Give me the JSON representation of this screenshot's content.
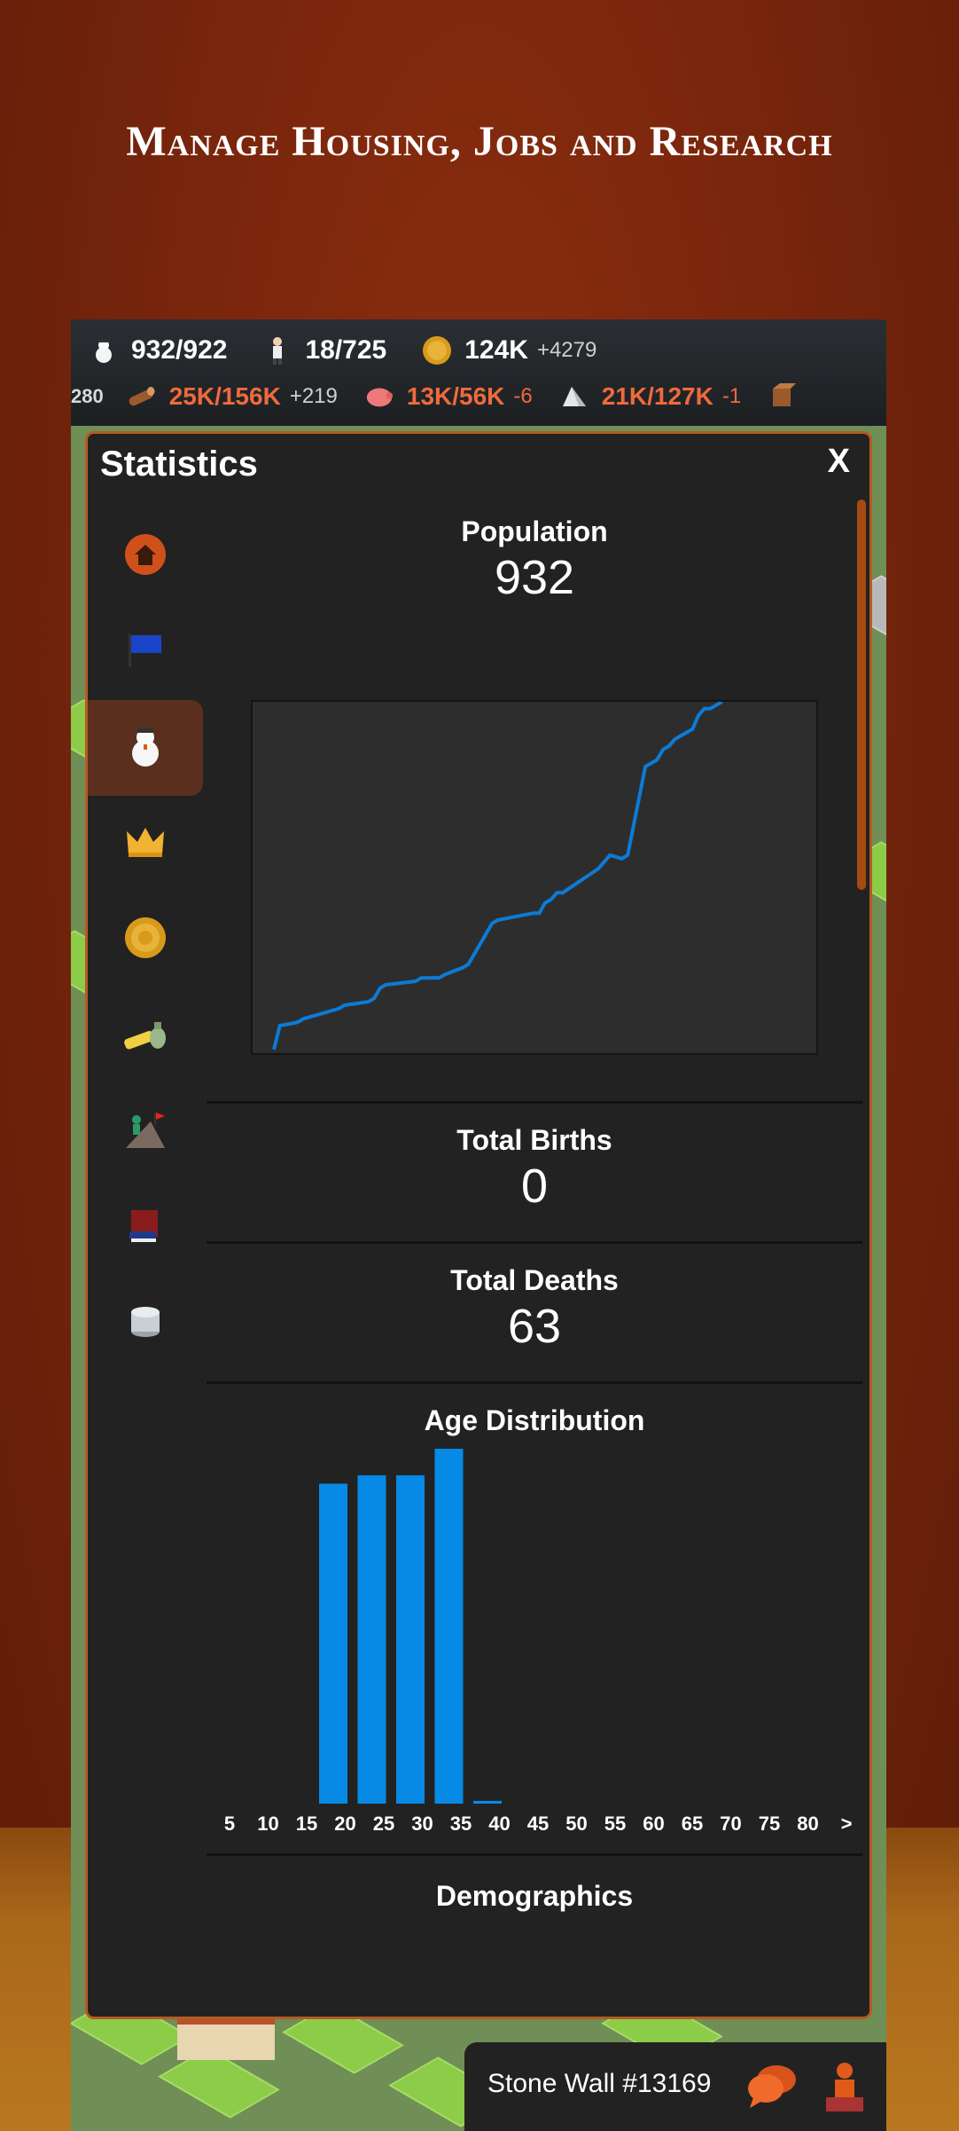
{
  "headline": "Manage Housing, Jobs and Research",
  "topbar": {
    "population": {
      "icon": "snowman-icon",
      "value": "932/922"
    },
    "workers": {
      "icon": "worker-icon",
      "value": "18/725"
    },
    "gold": {
      "icon": "coin-icon",
      "value": "124K",
      "delta": "+4279"
    },
    "cut_left": "280",
    "wood": {
      "icon": "wood-log-icon",
      "value": "25K/156K",
      "delta": "+219"
    },
    "food": {
      "icon": "pig-icon",
      "value": "13K/56K",
      "delta": "-6"
    },
    "stone": {
      "icon": "stone-icon",
      "value": "21K/127K",
      "delta": "-1"
    },
    "colors": {
      "warn": "#ef6a3c",
      "accent": "#b65a22",
      "bar": "#068ae6"
    }
  },
  "panel": {
    "title": "Statistics",
    "close_label": "X",
    "tabs": [
      {
        "name": "home-icon",
        "active": false
      },
      {
        "name": "flag-icon",
        "active": false
      },
      {
        "name": "snowman-icon",
        "active": true
      },
      {
        "name": "crown-icon",
        "active": false
      },
      {
        "name": "coin-icon",
        "active": false
      },
      {
        "name": "bread-resources-icon",
        "active": false
      },
      {
        "name": "climber-icon",
        "active": false
      },
      {
        "name": "books-icon",
        "active": false
      },
      {
        "name": "coins-stack-icon",
        "active": false
      }
    ],
    "population_label": "Population",
    "population_value": "932",
    "births_label": "Total Births",
    "births_value": "0",
    "deaths_label": "Total Deaths",
    "deaths_value": "63",
    "age_label": "Age Distribution",
    "demographics_label": "Demographics"
  },
  "chart_data": [
    {
      "type": "line",
      "series": [
        {
          "x": [
            0,
            1,
            4,
            5,
            11,
            12,
            16,
            17,
            18,
            19,
            24,
            25,
            28,
            29,
            32,
            33,
            37,
            38,
            44,
            45,
            46,
            47,
            48,
            49,
            55,
            56,
            57,
            59,
            60,
            63,
            64,
            65,
            66,
            67,
            68,
            69,
            70,
            71,
            72,
            73,
            74,
            75,
            76
          ],
          "y": [
            0,
            7,
            8,
            9,
            12,
            13,
            14,
            15,
            18,
            19,
            20,
            21,
            21,
            22,
            24,
            25,
            37,
            38,
            40,
            40,
            43,
            44,
            46,
            46,
            53,
            55,
            57,
            56,
            57,
            83,
            84,
            85,
            88,
            89,
            91,
            92,
            93,
            94,
            98,
            100,
            100,
            101,
            102
          ]
        }
      ],
      "grid": false
    },
    {
      "type": "bar",
      "categories": [
        "5",
        "10",
        "15",
        "20",
        "25",
        "30",
        "35",
        "40",
        "45",
        "50",
        "55",
        "60",
        "65",
        "70",
        "75",
        "80",
        ">"
      ],
      "values": [
        0,
        0,
        229,
        235,
        235,
        254,
        2,
        0,
        0,
        0,
        0,
        0,
        0,
        0,
        0,
        0,
        0
      ],
      "title": "Age Distribution"
    }
  ],
  "bottom": {
    "selected": "Stone Wall #13169",
    "chat_icon": "chat-bubbles-icon",
    "builder_icon": "builder-icon"
  }
}
